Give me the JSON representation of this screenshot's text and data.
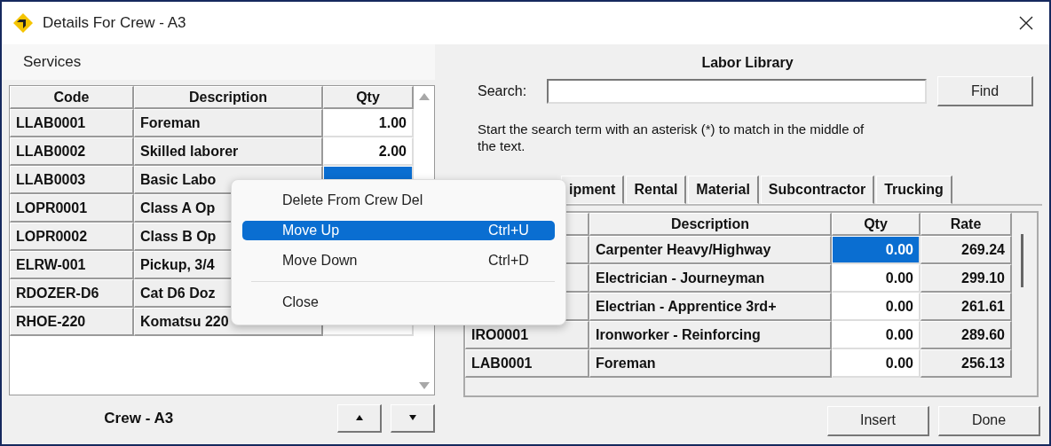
{
  "window": {
    "title": "Details For Crew - A3"
  },
  "services": {
    "title": "Services",
    "columns": [
      "Code",
      "Description",
      "Qty"
    ],
    "rows": [
      {
        "code": "LLAB0001",
        "description": "Foreman",
        "qty": "1.00",
        "selected": false
      },
      {
        "code": "LLAB0002",
        "description": "Skilled laborer",
        "qty": "2.00",
        "selected": false
      },
      {
        "code": "LLAB0003",
        "description": "Basic Labo",
        "selected": true
      },
      {
        "code": "LOPR0001",
        "description": "Class A Op"
      },
      {
        "code": "LOPR0002",
        "description": "Class B Op"
      },
      {
        "code": "ELRW-001",
        "description": "Pickup, 3/4"
      },
      {
        "code": "RDOZER-D6",
        "description": "Cat D6 Doz"
      },
      {
        "code": "RHOE-220",
        "description": "Komatsu 220",
        "selected": false
      }
    ],
    "footer": "Crew - A3"
  },
  "labor_library": {
    "title": "Labor Library",
    "search": {
      "label": "Search:",
      "button": "Find"
    },
    "hint": "Start the search term with an asterisk (*) to match in the middle of the text.",
    "tabs": [
      {
        "label": "ipment",
        "selected": false
      },
      {
        "label": "Rental",
        "selected": false
      },
      {
        "label": "Material",
        "selected": false
      },
      {
        "label": "Subcontractor",
        "selected": false
      },
      {
        "label": "Trucking",
        "selected": false
      }
    ],
    "columns": [
      "Description",
      "Qty",
      "Rate"
    ],
    "rows": [
      {
        "description": "Carpenter Heavy/Highway",
        "qty": "0.00",
        "rate": "269.24",
        "selected": true
      },
      {
        "description": "Electrician - Journeyman",
        "qty": "0.00",
        "rate": "299.10",
        "selected": false
      },
      {
        "description": "Electrian - Apprentice 3rd+",
        "qty": "0.00",
        "rate": "261.61",
        "selected": false
      },
      {
        "code": "IRO0001",
        "description": "Ironworker - Reinforcing",
        "qty": "0.00",
        "rate": "289.60",
        "selected": false
      },
      {
        "code": "LAB0001",
        "description": "Foreman",
        "qty": "0.00",
        "rate": "256.13",
        "selected": false
      }
    ],
    "buttons": [
      "Insert",
      "Done"
    ]
  },
  "context_menu": {
    "items": [
      {
        "kind": "item",
        "label": "Delete From Crew Del",
        "selected": false
      },
      {
        "kind": "item",
        "label": "Move Up",
        "shortcut": "Ctrl+U",
        "selected": true
      },
      {
        "kind": "item",
        "label": "Move Down",
        "shortcut": "Ctrl+D",
        "selected": false
      },
      {
        "kind": "separator"
      },
      {
        "kind": "item",
        "label": "Close",
        "selected": false
      }
    ]
  }
}
